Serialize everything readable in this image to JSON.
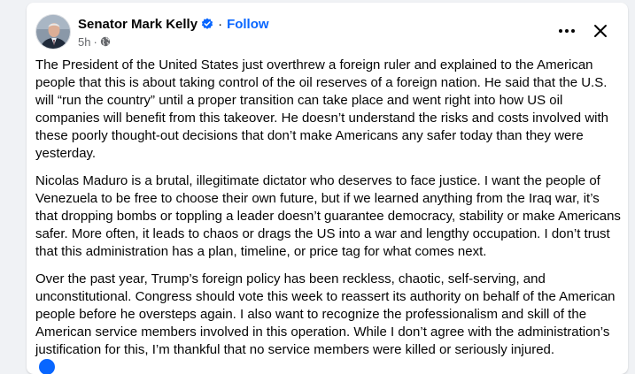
{
  "post": {
    "author": "Senator Mark Kelly",
    "follow_label": "Follow",
    "time": "5h",
    "separator": "·",
    "paragraphs": [
      "The President of the United States just overthrew a foreign ruler and explained to the American people that this is about taking control of the oil reserves of a foreign nation. He said that the U.S. will “run the country” until a proper transition can take place and went right into how US oil companies will benefit from this takeover. He doesn’t understand the risks and costs involved with these poorly thought-out decisions that don’t make Americans any safer today than they were yesterday.",
      "Nicolas Maduro is a brutal, illegitimate dictator who deserves to face justice. I want the people of Venezuela to be free to choose their own future, but if we learned anything from the Iraq war, it’s that dropping bombs or toppling a leader doesn’t guarantee democracy, stability or make Americans safer. More often, it leads to chaos or drags the US into a war and lengthy occupation. I don’t trust that this administration has a plan, timeline, or price tag for what comes next.",
      "Over the past year, Trump’s foreign policy has been reckless, chaotic, self-serving, and unconstitutional. Congress should vote this week to reassert its authority on behalf of the American people before he oversteps again.  I also want to recognize the professionalism and skill of the American service members involved in this operation. While I don’t agree with the administration’s justification for this, I’m thankful that no service members were killed or seriously injured."
    ]
  },
  "icons": {
    "verified": "verified-badge-icon",
    "audience": "globe-icon",
    "more": "more-options-icon",
    "close": "close-icon",
    "reaction": "like-reaction-icon"
  },
  "colors": {
    "accent": "#0866ff",
    "text": "#050505",
    "secondary_text": "#65676b",
    "page_background": "#f0f2f5"
  }
}
